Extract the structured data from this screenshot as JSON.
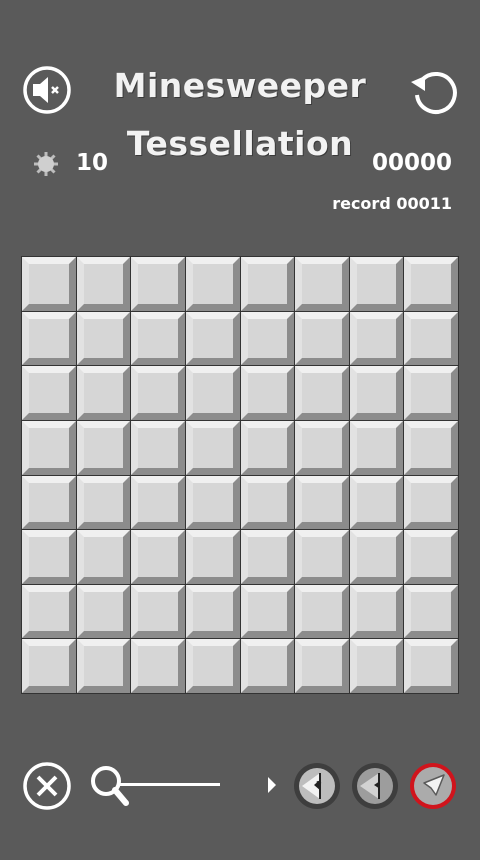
{
  "header": {
    "title_line1": "Minesweeper",
    "title_line2": "Tessellation",
    "sound_icon": "speaker-muted-icon",
    "restart_icon": "restart-icon"
  },
  "stats": {
    "mines_icon": "mine-icon",
    "mines_remaining": "10",
    "score": "00000",
    "record": "record 00011"
  },
  "board": {
    "rows": 8,
    "cols": 8,
    "cell_state": "unrevealed"
  },
  "toolbar": {
    "close_icon": "close-icon",
    "zoom_icon": "zoom-icon",
    "zoom_level": 0.0,
    "tools": [
      {
        "name": "question-flag-tool",
        "icon": "question-flag-icon",
        "selected": false
      },
      {
        "name": "flag-tool",
        "icon": "flag-icon",
        "selected": false
      },
      {
        "name": "reveal-tool",
        "icon": "cursor-icon",
        "selected": true
      }
    ],
    "selected_color": "#d0141c"
  }
}
